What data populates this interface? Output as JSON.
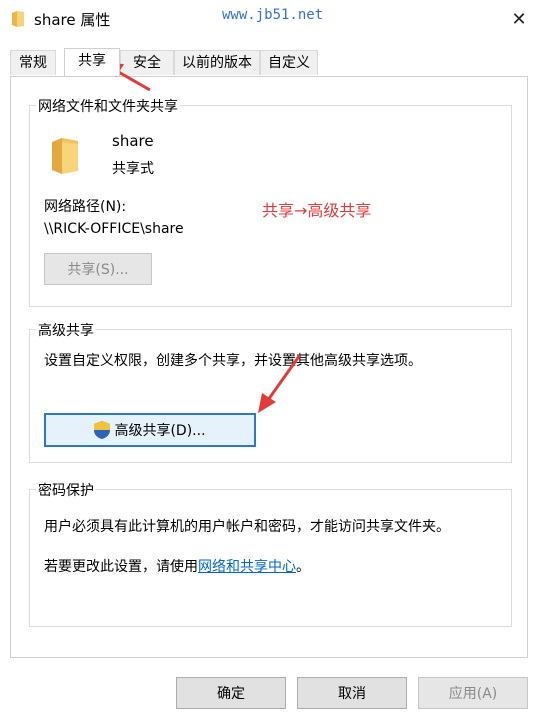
{
  "window": {
    "title": "share 属性",
    "watermark": "www.jb51.net"
  },
  "tabs": [
    {
      "label": "常规"
    },
    {
      "label": "共享"
    },
    {
      "label": "安全"
    },
    {
      "label": "以前的版本"
    },
    {
      "label": "自定义"
    }
  ],
  "network_share": {
    "group_label": "网络文件和文件夹共享",
    "folder_name": "share",
    "status": "共享式",
    "path_label": "网络路径(N):",
    "path_value": "\\\\RICK-OFFICE\\share",
    "share_button": "共享(S)..."
  },
  "annotation": {
    "text": "共享→高级共享",
    "color": "#e03c3c"
  },
  "advanced": {
    "group_label": "高级共享",
    "description": "设置自定义权限，创建多个共享，并设置其他高级共享选项。",
    "button": "高级共享(D)..."
  },
  "password": {
    "group_label": "密码保护",
    "description": "用户必须具有此计算机的用户帐户和密码，才能访问共享文件夹。",
    "change_prefix": "若要更改此设置，请使用",
    "change_link": "网络和共享中心",
    "change_suffix": "。"
  },
  "footer": {
    "ok": "确定",
    "cancel": "取消",
    "apply": "应用(A)"
  },
  "icons": {
    "folder": "folder-icon",
    "shield": "shield-icon",
    "close": "close-icon",
    "arrow": "red-arrow-icon"
  }
}
